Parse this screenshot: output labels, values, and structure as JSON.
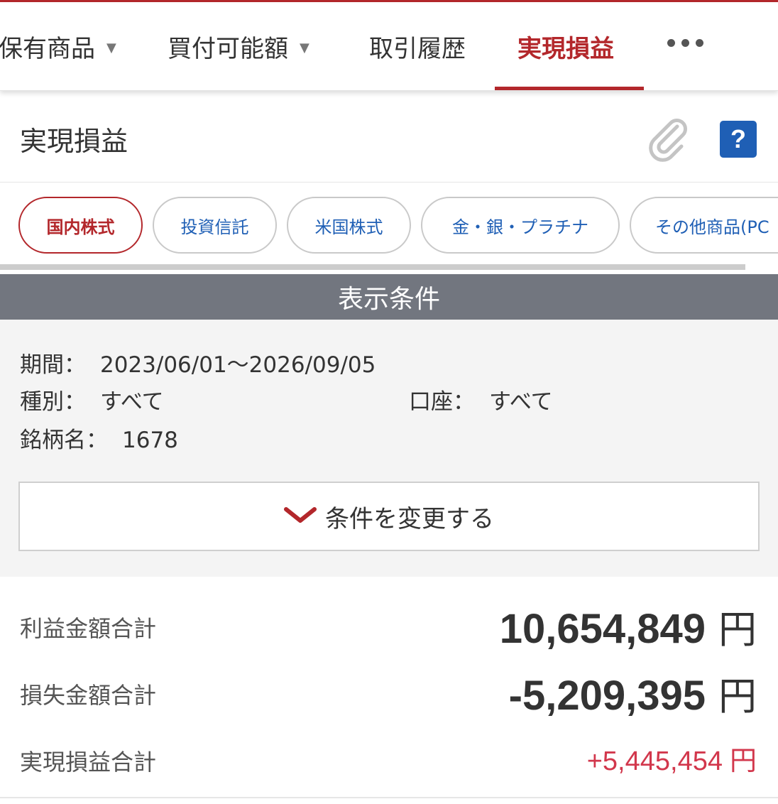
{
  "nav": {
    "tabs": [
      {
        "label": "保有商品",
        "caret": "▼"
      },
      {
        "label": "買付可能額",
        "caret": "▼"
      },
      {
        "label": "取引履歴"
      },
      {
        "label": "実現損益"
      }
    ],
    "active_tab": "実現損益",
    "more_icon": "more-horizontal-icon"
  },
  "header": {
    "title": "実現損益",
    "attach_icon": "paperclip-icon",
    "help_label": "?"
  },
  "product_tabs": {
    "items": [
      "国内株式",
      "投資信託",
      "米国株式",
      "金・銀・プラチナ",
      "その他商品(PC"
    ],
    "active": "国内株式"
  },
  "conditions": {
    "header": "表示条件",
    "period_label": "期間：",
    "period_value": "2023/06/01〜2026/09/05",
    "type_label": "種別：",
    "type_value": "すべて",
    "account_label": "口座：",
    "account_value": "すべて",
    "name_label": "銘柄名：",
    "name_value": "1678",
    "change_button": "条件を変更する",
    "change_icon": "chevron-down-icon"
  },
  "totals": {
    "profit_label": "利益金額合計",
    "profit_value": "10,654,849",
    "loss_label": "損失金額合計",
    "loss_value": "-5,209,395",
    "net_label": "実現損益合計",
    "net_value": "+5,445,454",
    "currency": "円"
  },
  "colors": {
    "accent_red": "#b3272b",
    "link_blue": "#1f5fb5",
    "gain_pink": "#d2374c",
    "header_gray": "#72767f"
  }
}
